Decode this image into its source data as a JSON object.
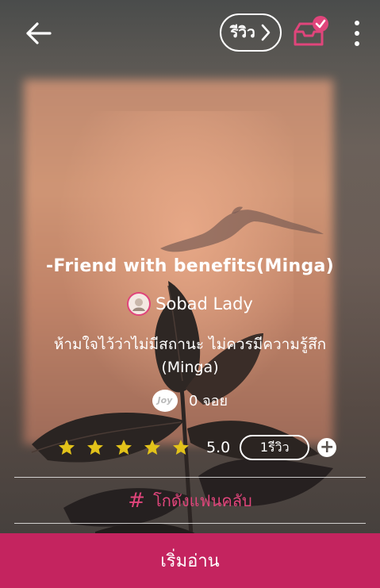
{
  "header": {
    "review_label": "รีวิว"
  },
  "novel": {
    "title": "-Friend with benefits(Minga)",
    "author": "Sobad Lady",
    "description": "ห้ามใจไว้ว่าไม่มีสถานะ ไม่ควรมีความรู้สึก (Minga)",
    "joy_badge": "Joy",
    "joy_count": "0 จอย",
    "rating_value": "5.0",
    "rating_stars": 5,
    "review_count": "1รีวิว",
    "add_review_symbol": "+"
  },
  "fanclub": {
    "label": "โกดังแฟนคลับ",
    "symbol": "#"
  },
  "footer": {
    "start_reading_label": "เริ่มอ่าน"
  },
  "colors": {
    "accent_pink": "#e0457b",
    "button_bg": "#c4245f",
    "star_yellow": "#e2c21a"
  },
  "icons": [
    "back-arrow-icon",
    "chevron-right-icon",
    "inbox-check-icon",
    "more-vertical-icon",
    "star-icon",
    "plus-icon",
    "hash-icon"
  ]
}
